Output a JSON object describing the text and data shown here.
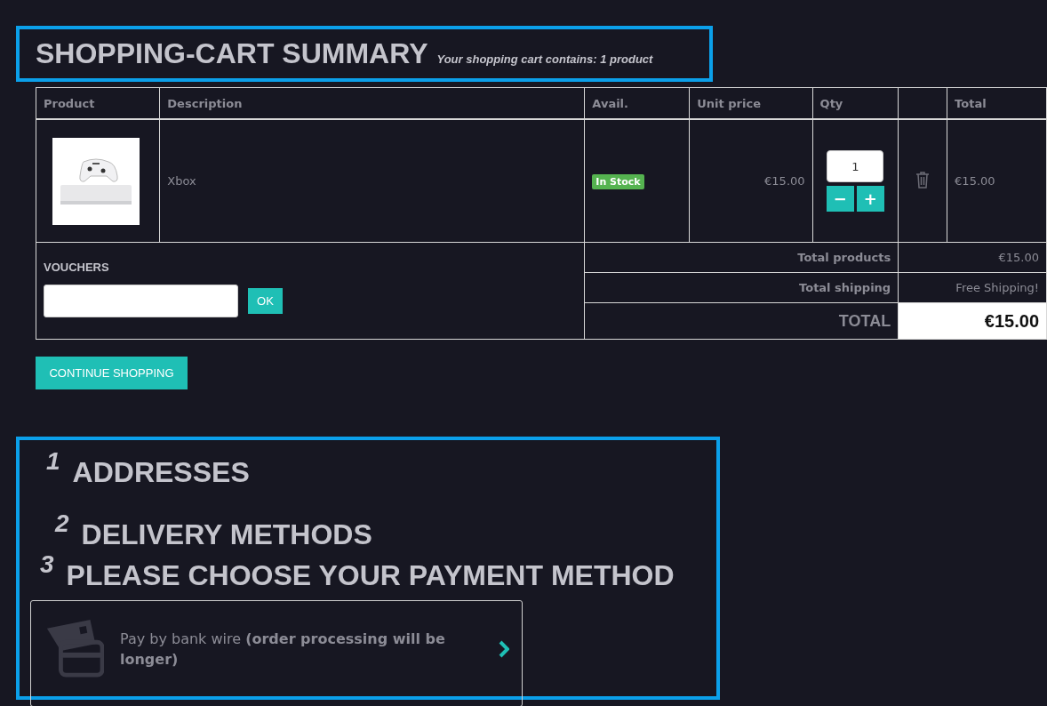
{
  "summary": {
    "title": "SHOPPING-CART SUMMARY",
    "subtitle": "Your shopping cart contains: 1 product"
  },
  "table": {
    "columns": [
      "Product",
      "Description",
      "Avail.",
      "Unit price",
      "Qty",
      "",
      "Total"
    ],
    "rows": [
      {
        "description": "Xbox",
        "availability": "In Stock",
        "unit_price": "€15.00",
        "qty": "1",
        "minus": "−",
        "plus": "+",
        "total": "€15.00"
      }
    ]
  },
  "totals": [
    {
      "kind": "line",
      "label": "Total products",
      "value": "€15.00"
    },
    {
      "kind": "line",
      "label": "Total shipping",
      "value": "Free Shipping!"
    },
    {
      "kind": "grand",
      "label": "TOTAL",
      "value": "€15.00"
    }
  ],
  "vouchers": {
    "title": "VOUCHERS",
    "button": "OK"
  },
  "continue_button": "CONTINUE SHOPPING",
  "steps": [
    {
      "number": "1",
      "title": "ADDRESSES"
    },
    {
      "number": "2",
      "title": "DELIVERY METHODS"
    },
    {
      "number": "3",
      "title": "PLEASE CHOOSE YOUR PAYMENT METHOD"
    }
  ],
  "payment_option": {
    "text": "Pay by bank wire **(order processing will be longer)**"
  }
}
